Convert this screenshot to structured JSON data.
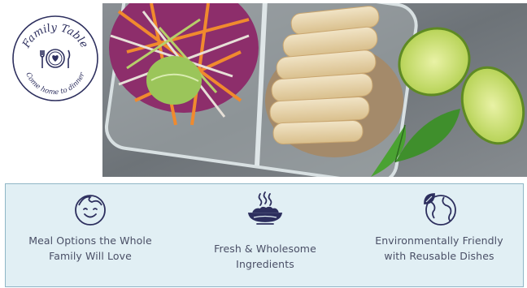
{
  "logo": {
    "title": "Family Table",
    "tagline": "Come home to dinner",
    "icon": "plate-heart-cutlery-icon"
  },
  "hero": {
    "image": "meal-prep-container-photo"
  },
  "features": [
    {
      "icon": "smiling-face-icon",
      "label": "Meal Options the Whole Family Will Love"
    },
    {
      "icon": "steaming-dish-icon",
      "label": "Fresh & Wholesome Ingredients"
    },
    {
      "icon": "globe-leaf-icon",
      "label": "Environmentally Friendly with Reusable Dishes"
    }
  ],
  "colors": {
    "brand_navy": "#2d2f5e",
    "panel_background": "#e1eff4",
    "panel_border": "#8fb6c6",
    "label_text": "#4a4f66"
  }
}
